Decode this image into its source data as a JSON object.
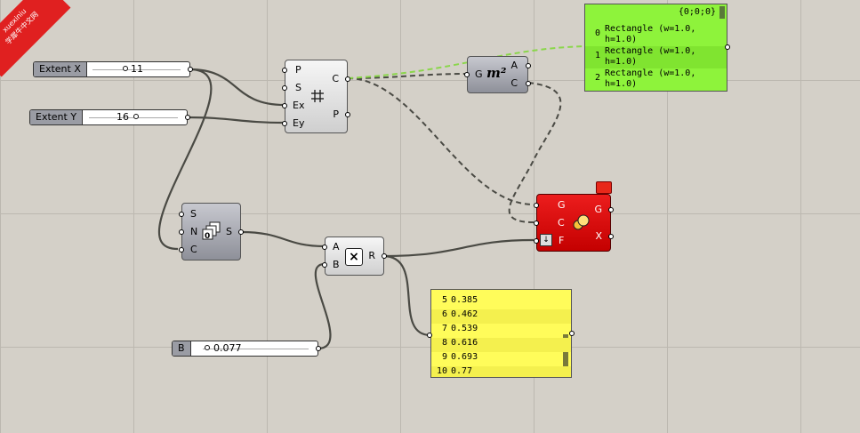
{
  "watermark": {
    "line1": "xuexiniu",
    "line2": "学犀牛中文网",
    "color": "#e02020"
  },
  "sliders": [
    {
      "label": "Extent X",
      "value": "11"
    },
    {
      "label": "Extent Y",
      "value": "16"
    },
    {
      "label": "B",
      "value": "0.077"
    }
  ],
  "rect_grid": {
    "inputs": [
      "P",
      "S",
      "Ex",
      "Ey"
    ],
    "outputs": [
      "C",
      "P"
    ],
    "icon": "rectangular-grid-icon"
  },
  "area": {
    "input": "G",
    "outputs": [
      "A",
      "C"
    ],
    "icon_text": "m²"
  },
  "series": {
    "inputs": [
      "S",
      "N",
      "C"
    ],
    "output": "S",
    "icon": "series-icon"
  },
  "multiply": {
    "inputs": [
      "A",
      "B"
    ],
    "output": "R",
    "icon_text": "×"
  },
  "scale": {
    "inputs": [
      "G",
      "C",
      "F"
    ],
    "outputs": [
      "G",
      "X"
    ],
    "icon": "scale-icon",
    "color": "#d40000"
  },
  "green_panel": {
    "path": "{0;0;0}",
    "rows": [
      {
        "index": "0",
        "lines": [
          "Rectangle (w=1.0,",
          "h=1.0)"
        ]
      },
      {
        "index": "1",
        "lines": [
          "Rectangle (w=1.0,",
          "h=1.0)"
        ]
      },
      {
        "index": "2",
        "lines": [
          "Rectangle (w=1.0,",
          "h=1.0)"
        ]
      }
    ],
    "color": "#8ef33b"
  },
  "yellow_panel": {
    "rows": [
      {
        "index": "5",
        "value": "0.385"
      },
      {
        "index": "6",
        "value": "0.462"
      },
      {
        "index": "7",
        "value": "0.539"
      },
      {
        "index": "8",
        "value": "0.616"
      },
      {
        "index": "9",
        "value": "0.693"
      },
      {
        "index": "10",
        "value": "0.77"
      }
    ],
    "color": "#fffc5a"
  }
}
